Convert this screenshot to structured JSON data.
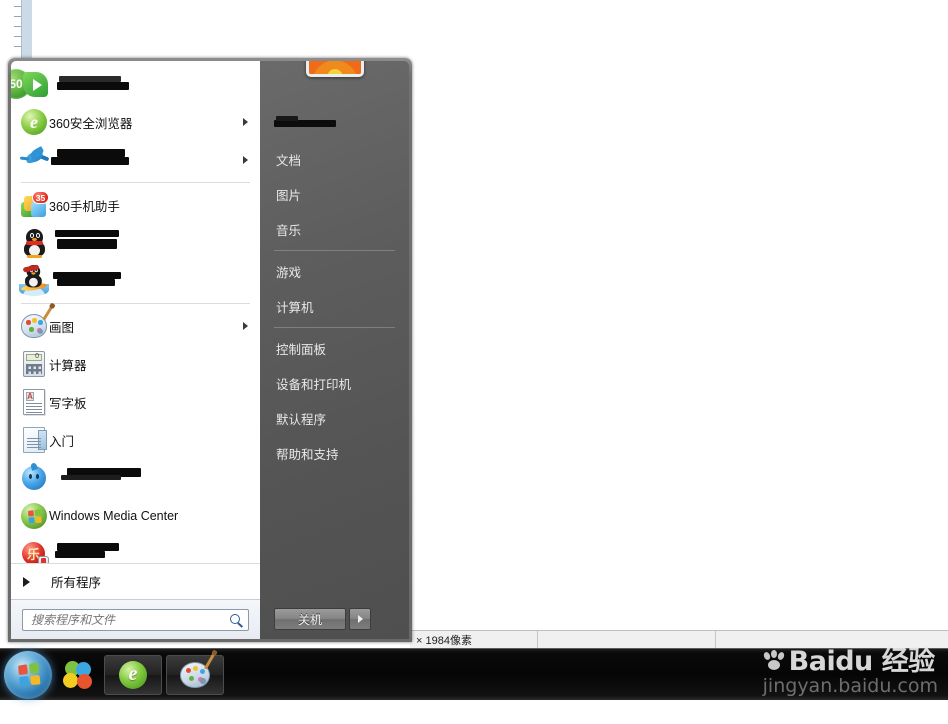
{
  "background_app": {
    "statusbar": {
      "cells": [
        "× 1984像素",
        "",
        ""
      ]
    }
  },
  "start_menu": {
    "programs": [
      {
        "label": "",
        "icon": "video-player-icon",
        "redacted": true,
        "has_submenu": false,
        "badge": "50"
      },
      {
        "label": "360安全浏览器",
        "icon": "360-browser-icon",
        "redacted": false,
        "has_submenu": true
      },
      {
        "label": "",
        "icon": "thunder-bird-icon",
        "redacted": true,
        "has_submenu": true
      },
      {
        "label": "360手机助手",
        "icon": "360-mobile-assistant-icon",
        "redacted": false,
        "has_submenu": false,
        "badge": "35"
      },
      {
        "label": "",
        "icon": "qq-penguin-icon",
        "redacted": true,
        "has_submenu": false
      },
      {
        "label": "",
        "icon": "qq-surf-icon",
        "redacted": true,
        "has_submenu": false
      },
      {
        "label": "画图",
        "icon": "paint-icon",
        "redacted": false,
        "has_submenu": true
      },
      {
        "label": "计算器",
        "icon": "calculator-icon",
        "redacted": false,
        "has_submenu": false
      },
      {
        "label": "写字板",
        "icon": "wordpad-icon",
        "redacted": false,
        "has_submenu": false
      },
      {
        "label": "入门",
        "icon": "getting-started-icon",
        "redacted": false,
        "has_submenu": false
      },
      {
        "label": "",
        "icon": "blue-assistant-icon",
        "redacted": true,
        "has_submenu": false
      },
      {
        "label": "Windows Media Center",
        "icon": "windows-media-center-icon",
        "redacted": false,
        "has_submenu": false
      },
      {
        "label": "",
        "icon": "red-shield-icon",
        "redacted": true,
        "has_submenu": false,
        "badge": "乐"
      }
    ],
    "all_programs": {
      "label": "所有程序"
    },
    "search": {
      "placeholder": "搜索程序和文件",
      "value": ""
    },
    "right_panel": {
      "user_name": "",
      "items": [
        {
          "label": "",
          "redacted": true,
          "group": 0
        },
        {
          "label": "文档",
          "redacted": false,
          "group": 0
        },
        {
          "label": "图片",
          "redacted": false,
          "group": 0
        },
        {
          "label": "音乐",
          "redacted": false,
          "group": 0
        },
        {
          "label": "游戏",
          "redacted": false,
          "group": 1
        },
        {
          "label": "计算机",
          "redacted": false,
          "group": 1
        },
        {
          "label": "控制面板",
          "redacted": false,
          "group": 2
        },
        {
          "label": "设备和打印机",
          "redacted": false,
          "group": 2
        },
        {
          "label": "默认程序",
          "redacted": false,
          "group": 2
        },
        {
          "label": "帮助和支持",
          "redacted": false,
          "group": 2
        }
      ],
      "shutdown_label": "关机"
    }
  },
  "taskbar": {
    "start_orb": "start-orb",
    "items": [
      {
        "name": "360-safe-cluster-icon",
        "pinned": false
      },
      {
        "name": "360-browser-taskbar-icon",
        "pinned": true
      },
      {
        "name": "paint-taskbar-icon",
        "pinned": true
      }
    ]
  },
  "watermark": {
    "brand": "Bai",
    "brand2": "du",
    "brand_cn": "经验",
    "url": "jingyan.baidu.com"
  },
  "colors": {
    "right_panel_bg": "#595959",
    "menu_frame": "#6a6a6a",
    "taskbar_bg": "#070707",
    "search_border": "#8a9aab",
    "accent_green": "#41a02e"
  }
}
